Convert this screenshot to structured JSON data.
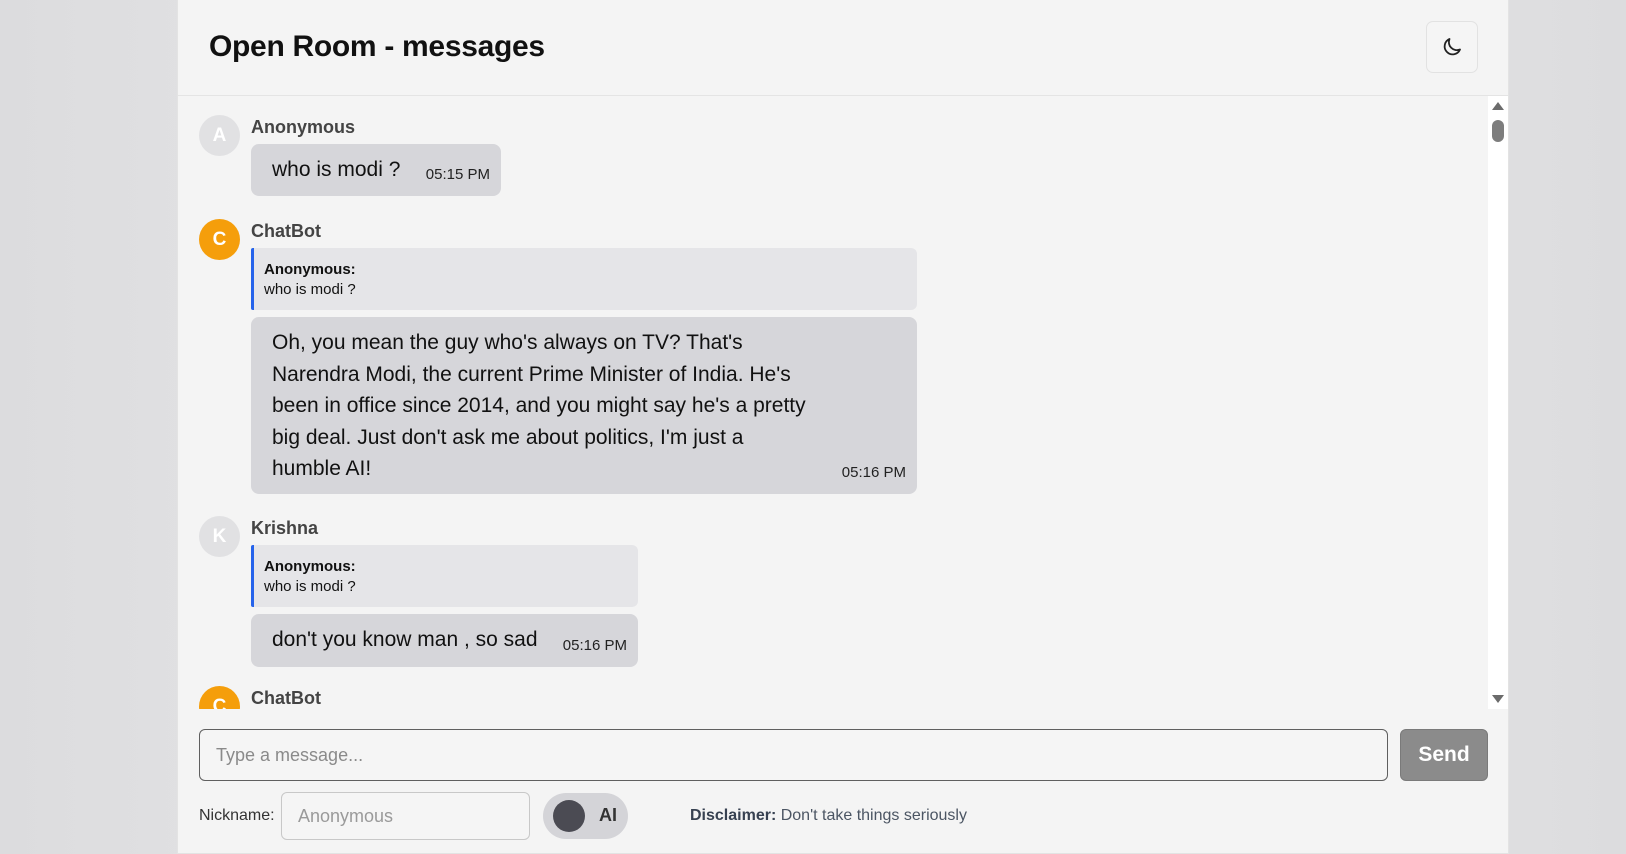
{
  "header": {
    "title": "Open Room - messages",
    "theme_icon": "moon-icon"
  },
  "messages": [
    {
      "avatar_letter": "A",
      "sender": "Anonymous",
      "text": "who is modi ?",
      "time": "05:15 PM",
      "is_bot": false
    },
    {
      "avatar_letter": "C",
      "sender": "ChatBot",
      "reply_to": {
        "author": "Anonymous:",
        "text": "who is modi ?"
      },
      "text_lines": [
        "Oh, you mean the guy who's always on TV? That's",
        "Narendra Modi, the current Prime Minister of India. He's",
        "been in office since 2014, and you might say he's a pretty",
        "big deal. Just don't ask me about politics, I'm just a",
        "humble AI!"
      ],
      "time": "05:16 PM",
      "is_bot": true
    },
    {
      "avatar_letter": "K",
      "sender": "Krishna",
      "reply_to": {
        "author": "Anonymous:",
        "text": "who is modi ?"
      },
      "text": "don't you know man , so sad",
      "time": "05:16 PM",
      "is_bot": false
    },
    {
      "avatar_letter": "C",
      "sender": "ChatBot",
      "is_bot": true
    }
  ],
  "composer": {
    "placeholder": "Type a message...",
    "send_label": "Send"
  },
  "footer": {
    "nickname_label": "Nickname:",
    "nickname_placeholder": "Anonymous",
    "ai_toggle_label": "AI",
    "disclaimer_label": "Disclaimer:",
    "disclaimer_text": "Don't take things seriously"
  },
  "colors": {
    "bot_avatar": "#f59e0b",
    "quote_border": "#2563eb",
    "send_button": "#8b8b8b"
  }
}
